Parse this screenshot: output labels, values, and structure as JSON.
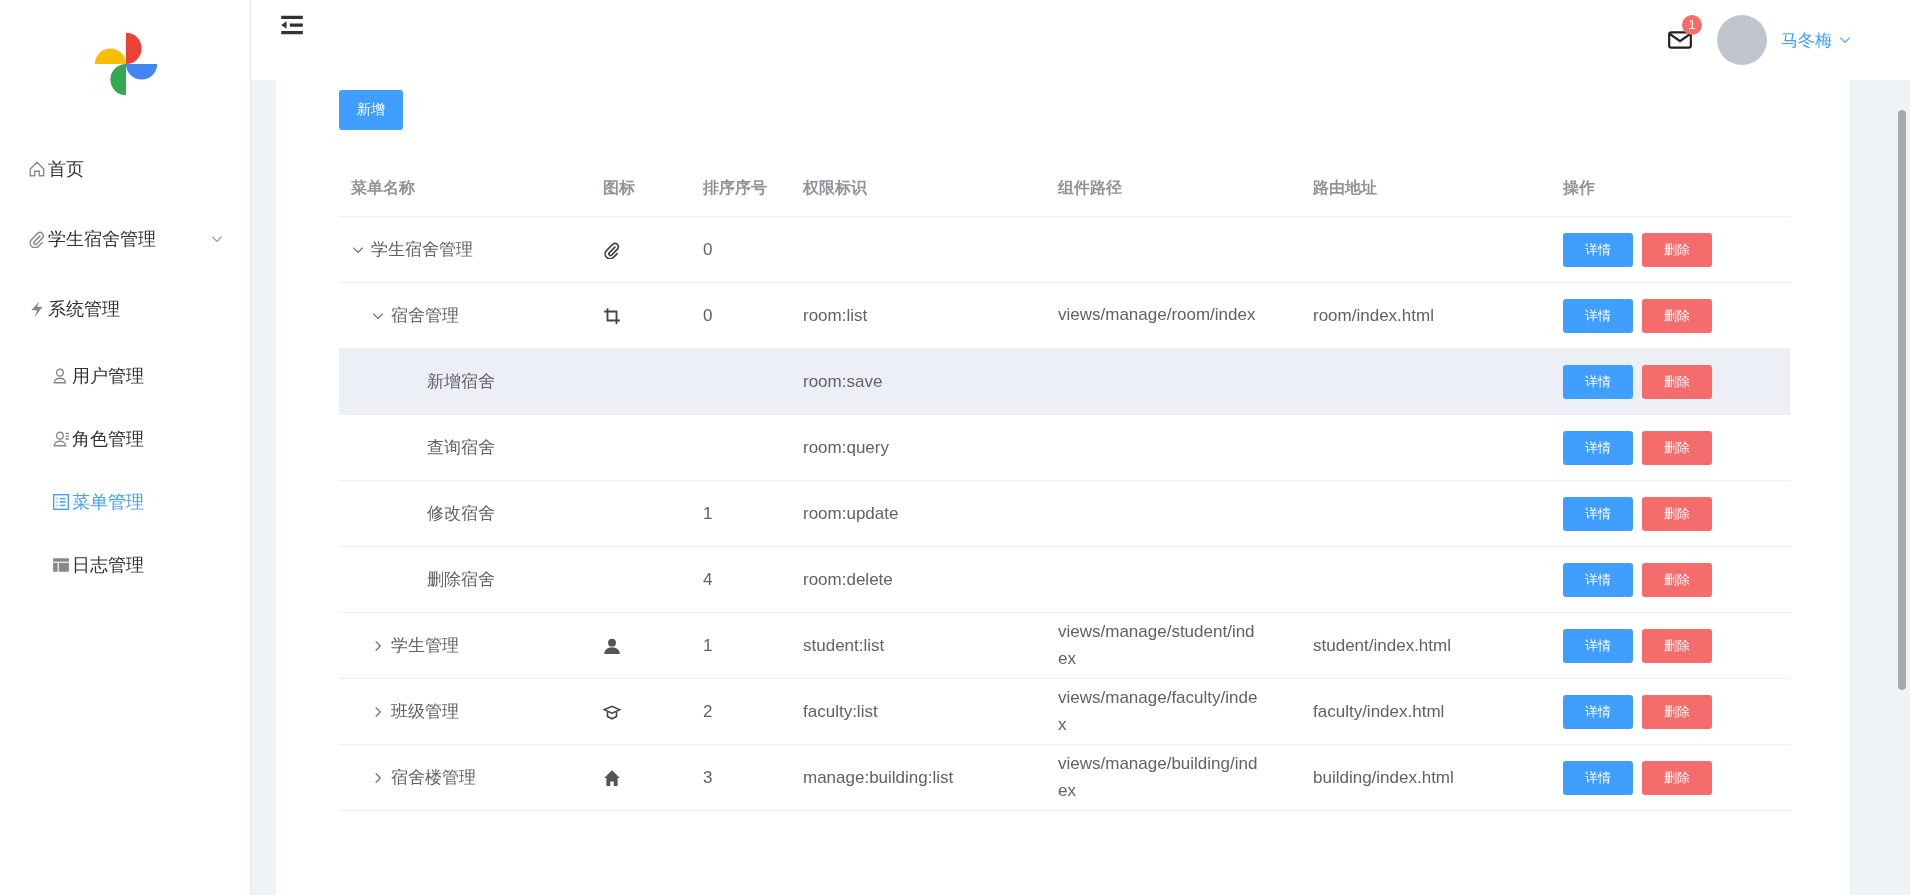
{
  "sidebar": {
    "items": [
      {
        "label": "首页",
        "selected": false
      },
      {
        "label": "学生宿舍管理",
        "selected": false,
        "expanded": false
      },
      {
        "label": "系统管理",
        "selected": false,
        "expanded": true,
        "children": [
          {
            "label": "用户管理",
            "selected": false
          },
          {
            "label": "角色管理",
            "selected": false
          },
          {
            "label": "菜单管理",
            "selected": true
          },
          {
            "label": "日志管理",
            "selected": false
          }
        ]
      }
    ]
  },
  "header": {
    "notifications": "1",
    "user": "马冬梅"
  },
  "add_button": "新增",
  "table": {
    "columns": [
      "菜单名称",
      "图标",
      "排序序号",
      "权限标识",
      "组件路径",
      "路由地址",
      "操作"
    ],
    "rows": [
      {
        "name": "学生宿舍管理",
        "order": "0",
        "expanded": true,
        "highlighted": false,
        "actions": [
          "详情",
          "删除"
        ],
        "children": [
          {
            "name": "宿舍管理",
            "order": "0",
            "perm": "room:list",
            "component": "views/manage/room/index",
            "route": "room/index.html",
            "expanded": true,
            "highlighted": false,
            "actions": [
              "详情",
              "删除"
            ],
            "children": [
              {
                "name": "新增宿舍",
                "perm": "room:save",
                "highlighted": true,
                "actions": [
                  "详情",
                  "删除"
                ]
              },
              {
                "name": "查询宿舍",
                "perm": "room:query",
                "highlighted": false,
                "actions": [
                  "详情",
                  "删除"
                ]
              },
              {
                "name": "修改宿舍",
                "order": "1",
                "perm": "room:update",
                "highlighted": false,
                "actions": [
                  "详情",
                  "删除"
                ]
              },
              {
                "name": "删除宿舍",
                "order": "4",
                "perm": "room:delete",
                "highlighted": false,
                "actions": [
                  "详情",
                  "删除"
                ]
              }
            ]
          },
          {
            "name": "学生管理",
            "order": "1",
            "perm": "student:list",
            "component": "views/manage/student/index",
            "route": "student/index.html",
            "expanded": false,
            "highlighted": false,
            "actions": [
              "详情",
              "删除"
            ]
          },
          {
            "name": "班级管理",
            "order": "2",
            "perm": "faculty:list",
            "component": "views/manage/faculty/index",
            "route": "faculty/index.html",
            "expanded": false,
            "highlighted": false,
            "actions": [
              "详情",
              "删除"
            ]
          },
          {
            "name": "宿舍楼管理",
            "order": "3",
            "perm": "manage:building:list",
            "component": "views/manage/building/index",
            "route": "building/index.html",
            "expanded": false,
            "highlighted": false,
            "actions": [
              "详情",
              "删除"
            ]
          }
        ]
      }
    ]
  }
}
